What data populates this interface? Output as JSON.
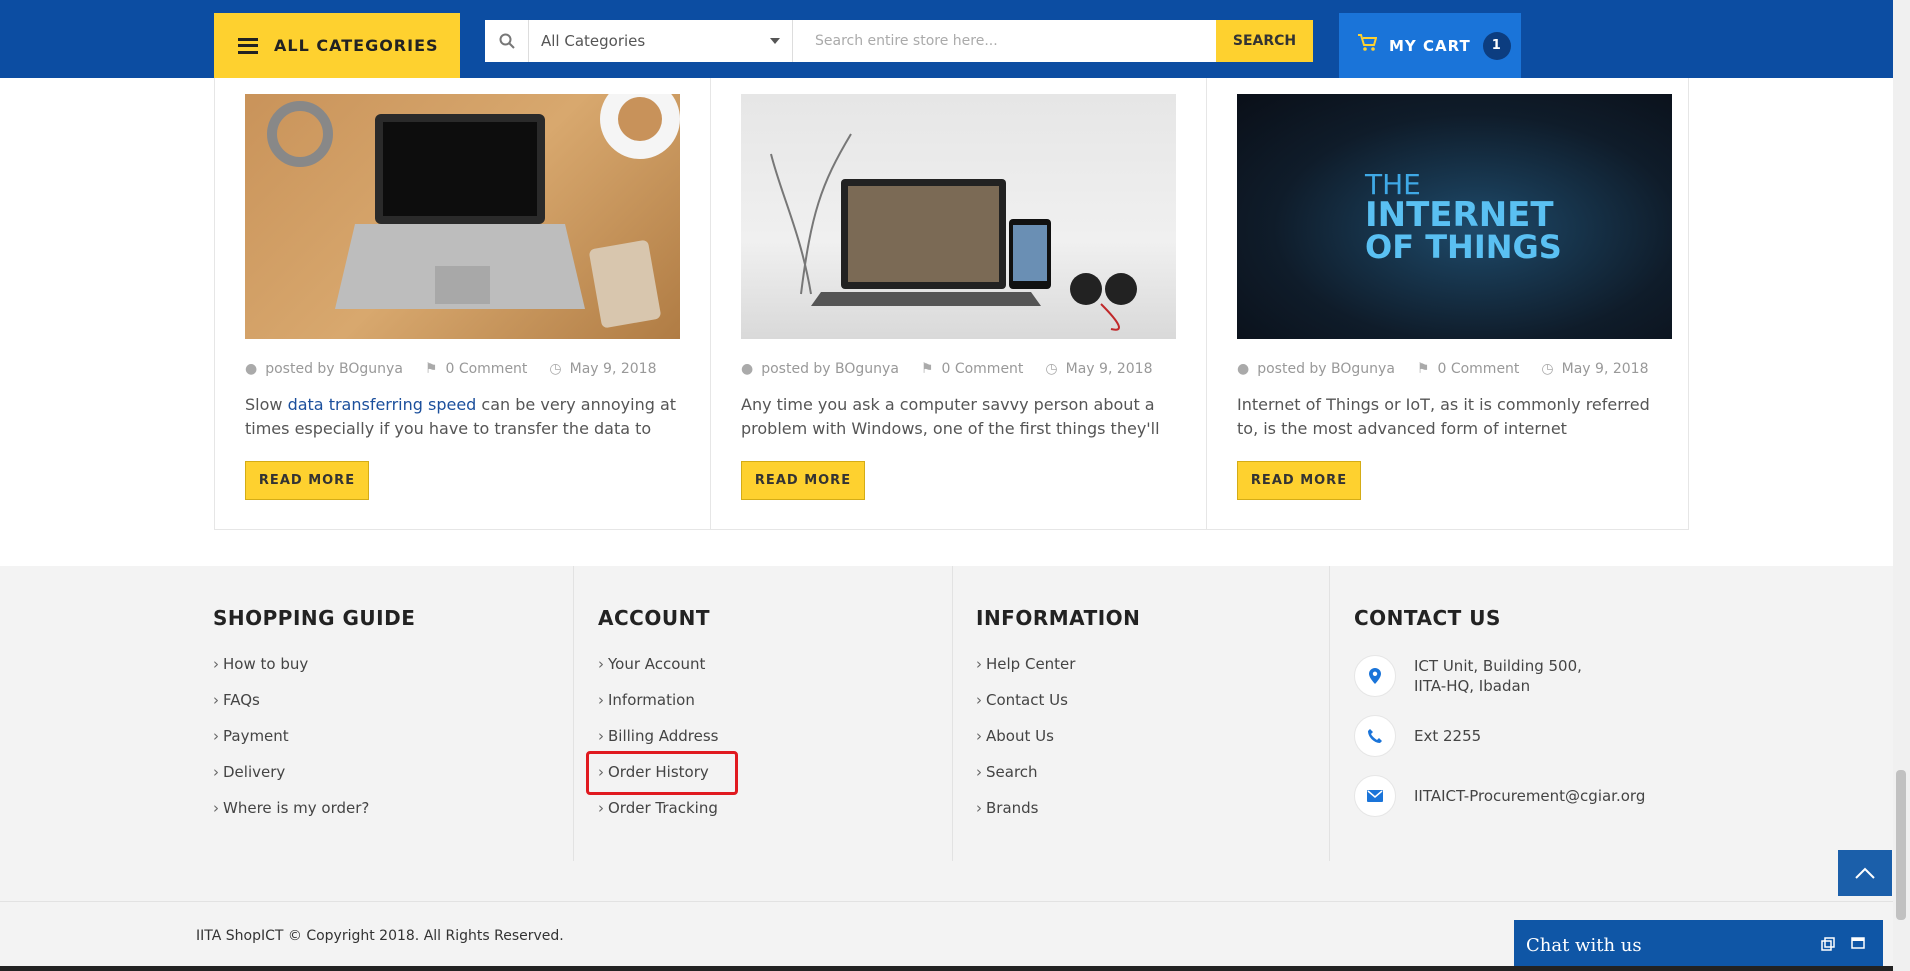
{
  "header": {
    "all_categories_label": "ALL CATEGORIES",
    "category_select_value": "All Categories",
    "search_placeholder": "Search entire store here...",
    "search_button": "SEARCH",
    "cart_label": "MY CART",
    "cart_count": "1"
  },
  "posts": [
    {
      "author": "posted by BOgunya",
      "comments": "0 Comment",
      "date": "May 9, 2018",
      "excerpt_pre": "Slow ",
      "excerpt_link": "data transferring speed",
      "excerpt_post": " can be very annoying at times especially if you have to transfer the data to",
      "read_more": "READ MORE"
    },
    {
      "author": "posted by BOgunya",
      "comments": "0 Comment",
      "date": "May 9, 2018",
      "excerpt_pre": "Any time you ask a computer savvy person about a problem with Windows, one of the first things they'll",
      "excerpt_link": "",
      "excerpt_post": "",
      "read_more": "READ MORE"
    },
    {
      "author": "posted by BOgunya",
      "comments": "0 Comment",
      "date": "May 9, 2018",
      "excerpt_pre": "Internet of Things or IoT, as it is commonly referred to, is the most advanced form of internet",
      "excerpt_link": "",
      "excerpt_post": "",
      "read_more": "READ MORE",
      "image_title_line1": "THE",
      "image_title_line2": "INTERNET",
      "image_title_line3": "OF THINGS"
    }
  ],
  "footer": {
    "shopping_guide": {
      "title": "SHOPPING GUIDE",
      "items": [
        "How to buy",
        "FAQs",
        "Payment",
        "Delivery",
        "Where is my order?"
      ]
    },
    "account": {
      "title": "ACCOUNT",
      "items": [
        "Your Account",
        "Information",
        "Billing Address",
        "Order History",
        "Order Tracking"
      ]
    },
    "information": {
      "title": "INFORMATION",
      "items": [
        "Help Center",
        "Contact Us",
        "About Us",
        "Search",
        "Brands"
      ]
    },
    "contact": {
      "title": "CONTACT US",
      "address_line1": "ICT Unit, Building 500,",
      "address_line2": "IITA-HQ, Ibadan",
      "phone": "Ext 2255",
      "email": "IITAICT-Procurement@cgiar.org"
    },
    "copyright": "IITA ShopICT © Copyright 2018. All Rights Reserved."
  },
  "chat": {
    "label": "Chat with us"
  },
  "colors": {
    "brand_blue": "#0c4da2",
    "accent_yellow": "#fed12f",
    "highlight_red": "#e0191f"
  }
}
